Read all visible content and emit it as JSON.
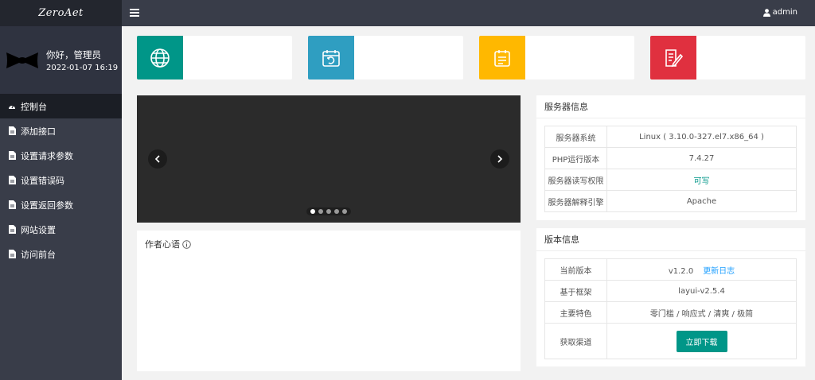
{
  "app": {
    "logo_text": "ZeroAet"
  },
  "user": {
    "greeting": "你好，管理员",
    "datetime": "2022-01-07 16:19"
  },
  "header": {
    "username": "admin"
  },
  "nav": {
    "items": [
      {
        "label": "控制台",
        "icon": "dashboard-icon",
        "active": true
      },
      {
        "label": "添加接口",
        "icon": "file-icon"
      },
      {
        "label": "设置请求参数",
        "icon": "file-icon"
      },
      {
        "label": "设置错误码",
        "icon": "file-icon"
      },
      {
        "label": "设置返回参数",
        "icon": "file-icon"
      },
      {
        "label": "网站设置",
        "icon": "file-icon"
      },
      {
        "label": "访问前台",
        "icon": "file-icon"
      }
    ]
  },
  "cards": [
    {
      "icon": "globe-icon",
      "color": "#009688"
    },
    {
      "icon": "calendar-refresh-icon",
      "color": "#2f9ec1"
    },
    {
      "icon": "calendar-list-icon",
      "color": "#ffb800"
    },
    {
      "icon": "edit-document-icon",
      "color": "#e0303f"
    }
  ],
  "carousel": {
    "slide_count": 5,
    "active_index": 0
  },
  "author": {
    "title": "作者心语"
  },
  "server_info": {
    "title": "服务器信息",
    "rows": [
      {
        "label": "服务器系统",
        "value": "Linux ( 3.10.0-327.el7.x86_64 )"
      },
      {
        "label": "PHP运行版本",
        "value": "7.4.27"
      },
      {
        "label": "服务器读写权限",
        "value": "可写"
      },
      {
        "label": "服务器解释引擎",
        "value": "Apache"
      }
    ]
  },
  "version_info": {
    "title": "版本信息",
    "current_label": "当前版本",
    "current_value": "v1.2.0",
    "changelog_link": "更新日志",
    "framework_label": "基于框架",
    "framework_value": "layui-v2.5.4",
    "features_label": "主要特色",
    "features_value": "零门槛 / 响应式 / 清爽 / 极简",
    "download_label": "获取渠道",
    "download_button": "立即下载"
  },
  "colors": {
    "sidebar": "#393d49",
    "accent": "#009688",
    "link": "#1e9fff"
  }
}
